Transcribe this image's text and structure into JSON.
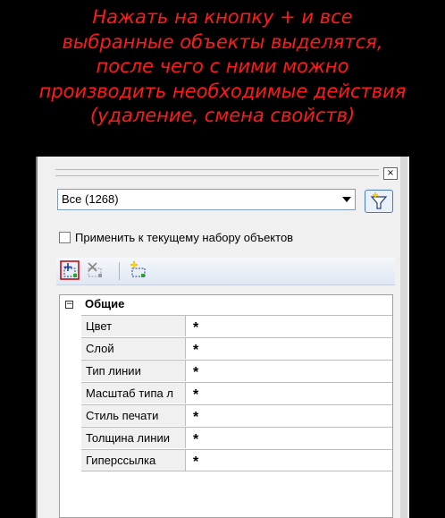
{
  "caption": {
    "lines": [
      "Нажать на кнопку + и все",
      "выбранные объекты выделятся,",
      "после чего с ними можно",
      "производить необходимые действия",
      "(удаление, смена свойств)"
    ],
    "color": "#ff1a1a"
  },
  "panel": {
    "close_glyph": "×",
    "selection_dropdown": {
      "value": "Все (1268)"
    },
    "apply_checkbox": {
      "label": "Применить к текущему набору объектов",
      "checked": false
    },
    "toolbar": {
      "buttons": [
        "add-to-selection-icon",
        "remove-from-selection-icon",
        "quick-select-icon"
      ]
    },
    "properties": {
      "category": {
        "label": "Общие",
        "expander": "−"
      },
      "rows": [
        {
          "name": "Цвет",
          "value": "*"
        },
        {
          "name": "Слой",
          "value": "*"
        },
        {
          "name": "Тип линии",
          "value": "*"
        },
        {
          "name": "Масштаб типа л",
          "value": "*"
        },
        {
          "name": "Стиль печати",
          "value": "*"
        },
        {
          "name": "Толщина линии",
          "value": "*"
        },
        {
          "name": "Гиперссылка",
          "value": "*"
        }
      ]
    }
  }
}
